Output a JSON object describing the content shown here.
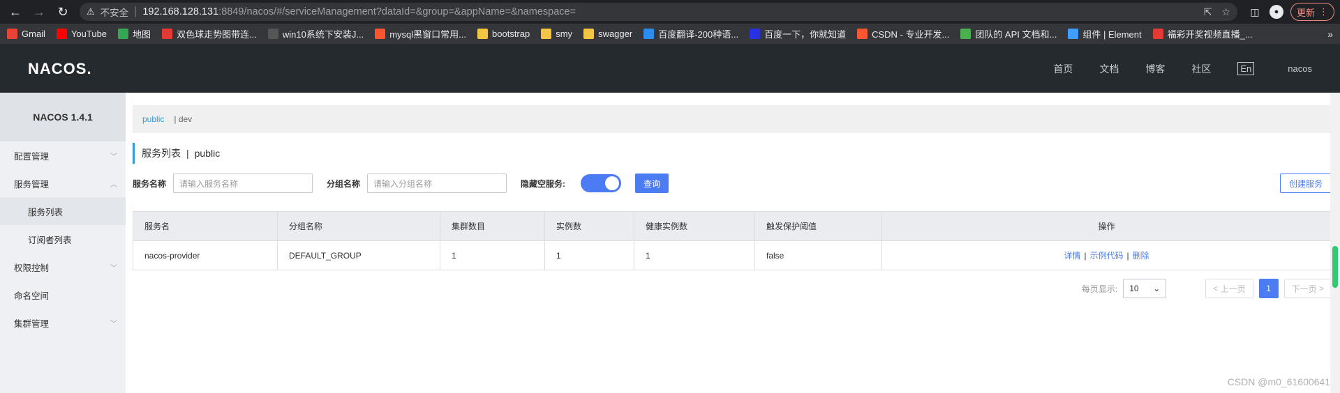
{
  "browser": {
    "insecure_label": "不安全",
    "url_host": "192.168.128.131",
    "url_rest": ":8849/nacos/#/serviceManagement?dataId=&group=&appName=&namespace=",
    "update_label": "更新"
  },
  "bookmarks": [
    {
      "label": "Gmail",
      "icon": "gmail-icon",
      "color": "#ea4335"
    },
    {
      "label": "YouTube",
      "icon": "youtube-icon",
      "color": "#ff0000"
    },
    {
      "label": "地图",
      "icon": "maps-icon",
      "color": "#34a853"
    },
    {
      "label": "双色球走势图带连...",
      "icon": "lottery-icon",
      "color": "#e53935"
    },
    {
      "label": "win10系统下安装J...",
      "icon": "win-icon",
      "color": "#555555"
    },
    {
      "label": "mysql黑窗口常用...",
      "icon": "csdn-icon",
      "color": "#fc5531"
    },
    {
      "label": "bootstrap",
      "icon": "folder-icon",
      "color": "#f4c542"
    },
    {
      "label": "smy",
      "icon": "folder-icon",
      "color": "#f4c542"
    },
    {
      "label": "swagger",
      "icon": "folder-icon",
      "color": "#f4c542"
    },
    {
      "label": "百度翻译-200种语...",
      "icon": "baidu-translate-icon",
      "color": "#2d8cf0"
    },
    {
      "label": "百度一下，你就知道",
      "icon": "baidu-icon",
      "color": "#2932e1"
    },
    {
      "label": "CSDN - 专业开发...",
      "icon": "csdn-icon",
      "color": "#fc5531"
    },
    {
      "label": "团队的 API 文档和...",
      "icon": "api-icon",
      "color": "#4caf50"
    },
    {
      "label": "组件 | Element",
      "icon": "element-icon",
      "color": "#409eff"
    },
    {
      "label": "福彩开奖视频直播_...",
      "icon": "lottery-live-icon",
      "color": "#e53935"
    }
  ],
  "header": {
    "logo": "NACOS.",
    "nav": [
      "首页",
      "文档",
      "博客",
      "社区"
    ],
    "lang": "En",
    "user": "nacos"
  },
  "sidebar": {
    "title": "NACOS 1.4.1",
    "items": [
      {
        "label": "配置管理",
        "chevron": "down"
      },
      {
        "label": "服务管理",
        "chevron": "up"
      },
      {
        "label": "服务列表",
        "sub": true,
        "active": true
      },
      {
        "label": "订阅者列表",
        "sub": true
      },
      {
        "label": "权限控制",
        "chevron": "down"
      },
      {
        "label": "命名空间"
      },
      {
        "label": "集群管理",
        "chevron": "down"
      }
    ]
  },
  "namespaces": {
    "active": "public",
    "other": "dev"
  },
  "page": {
    "title": "服务列表",
    "namespace": "public"
  },
  "filters": {
    "service_name_label": "服务名称",
    "service_name_placeholder": "请输入服务名称",
    "group_name_label": "分组名称",
    "group_name_placeholder": "请输入分组名称",
    "hide_empty_label": "隐藏空服务:",
    "hide_empty_on": true,
    "query_button": "查询",
    "create_button": "创建服务"
  },
  "table": {
    "headers": [
      "服务名",
      "分组名称",
      "集群数目",
      "实例数",
      "健康实例数",
      "触发保护阈值",
      "操作"
    ],
    "rows": [
      {
        "service": "nacos-provider",
        "group": "DEFAULT_GROUP",
        "clusters": "1",
        "instances": "1",
        "healthy": "1",
        "threshold": "false"
      }
    ],
    "ops": [
      "详情",
      "示例代码",
      "删除"
    ]
  },
  "pager": {
    "page_size_label": "每页显示:",
    "page_size": "10",
    "prev": "上一页",
    "next": "下一页",
    "current": "1"
  },
  "watermark": "CSDN @m0_61600641"
}
